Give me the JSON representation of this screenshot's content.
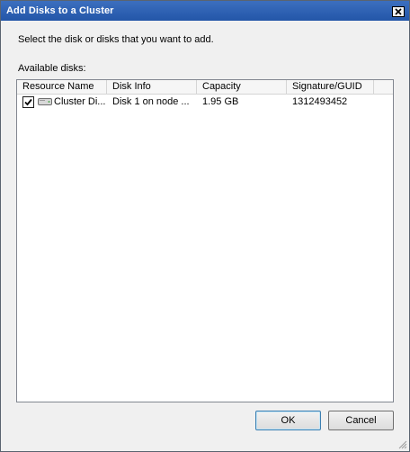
{
  "window": {
    "title": "Add Disks to a Cluster"
  },
  "instruction": "Select the disk or disks that you want to add.",
  "available_label": "Available disks:",
  "table": {
    "columns": [
      "Resource Name",
      "Disk Info",
      "Capacity",
      "Signature/GUID"
    ],
    "rows": [
      {
        "checked": true,
        "resource_name": "Cluster Di...",
        "disk_info": "Disk 1 on node ...",
        "capacity": "1.95 GB",
        "signature": "1312493452"
      }
    ]
  },
  "buttons": {
    "ok": "OK",
    "cancel": "Cancel"
  },
  "icons": {
    "close": "close-icon",
    "disk": "disk-drive-icon",
    "check": "checkmark-icon",
    "grip": "resize-grip-icon"
  },
  "colors": {
    "titlebar": "#2a5fb0",
    "dialog_bg": "#f0f0f0",
    "default_button_border": "#3c7fb1"
  }
}
